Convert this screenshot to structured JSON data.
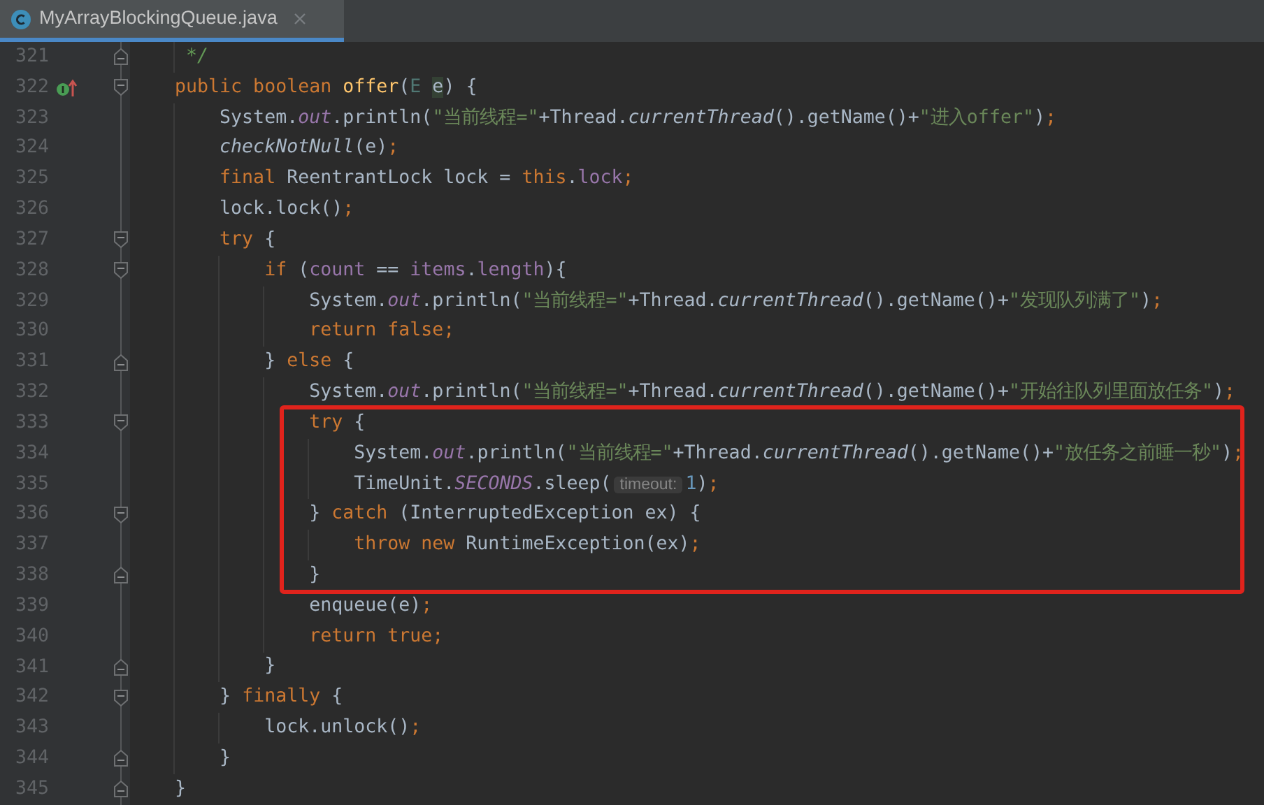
{
  "tab": {
    "title": "MyArrayBlockingQueue.java",
    "selected": true
  },
  "lines": [
    {
      "number": "321",
      "fold": {
        "kind": "end"
      },
      "framed": false,
      "tokens": [
        {
          "kind": "comment",
          "text": "     */"
        }
      ]
    },
    {
      "number": "322",
      "fold": {
        "kind": "start"
      },
      "gutter_icon": {
        "kind": "implements"
      },
      "framed": false,
      "tokens": [
        {
          "kind": "keyword",
          "text": "    public boolean "
        },
        {
          "kind": "method",
          "text": "offer"
        },
        {
          "kind": "plain",
          "text": "("
        },
        {
          "kind": "type_param",
          "text": "E "
        },
        {
          "kind": "highlight",
          "text": "e"
        },
        {
          "kind": "plain",
          "text": ") {"
        }
      ]
    },
    {
      "number": "323",
      "framed": false,
      "tokens": [
        {
          "kind": "plain",
          "text": "        System."
        },
        {
          "kind": "static_field",
          "text": "out"
        },
        {
          "kind": "plain",
          "text": ".println("
        },
        {
          "kind": "string",
          "text": "\"当前线程=\""
        },
        {
          "kind": "plain",
          "text": "+Thread."
        },
        {
          "kind": "static_method",
          "text": "currentThread"
        },
        {
          "kind": "plain",
          "text": "().getName()+"
        },
        {
          "kind": "string",
          "text": "\"进入offer\""
        },
        {
          "kind": "plain",
          "text": ")"
        },
        {
          "kind": "keyword",
          "text": ";"
        }
      ]
    },
    {
      "number": "324",
      "framed": false,
      "tokens": [
        {
          "kind": "static_method",
          "text": "        checkNotNull"
        },
        {
          "kind": "plain",
          "text": "(e)"
        },
        {
          "kind": "keyword",
          "text": ";"
        }
      ]
    },
    {
      "number": "325",
      "framed": false,
      "tokens": [
        {
          "kind": "keyword",
          "text": "        final "
        },
        {
          "kind": "plain",
          "text": "ReentrantLock lock = "
        },
        {
          "kind": "keyword",
          "text": "this"
        },
        {
          "kind": "plain",
          "text": "."
        },
        {
          "kind": "field",
          "text": "lock"
        },
        {
          "kind": "keyword",
          "text": ";"
        }
      ]
    },
    {
      "number": "326",
      "framed": false,
      "tokens": [
        {
          "kind": "plain",
          "text": "        lock.lock()"
        },
        {
          "kind": "keyword",
          "text": ";"
        }
      ]
    },
    {
      "number": "327",
      "fold": {
        "kind": "start"
      },
      "framed": false,
      "tokens": [
        {
          "kind": "keyword",
          "text": "        try "
        },
        {
          "kind": "plain",
          "text": "{"
        }
      ]
    },
    {
      "number": "328",
      "fold": {
        "kind": "start"
      },
      "framed": false,
      "tokens": [
        {
          "kind": "keyword",
          "text": "            if "
        },
        {
          "kind": "plain",
          "text": "("
        },
        {
          "kind": "field",
          "text": "count"
        },
        {
          "kind": "plain",
          "text": " == "
        },
        {
          "kind": "field",
          "text": "items"
        },
        {
          "kind": "plain",
          "text": "."
        },
        {
          "kind": "field",
          "text": "length"
        },
        {
          "kind": "plain",
          "text": "){"
        }
      ]
    },
    {
      "number": "329",
      "framed": false,
      "tokens": [
        {
          "kind": "plain",
          "text": "                System."
        },
        {
          "kind": "static_field",
          "text": "out"
        },
        {
          "kind": "plain",
          "text": ".println("
        },
        {
          "kind": "string",
          "text": "\"当前线程=\""
        },
        {
          "kind": "plain",
          "text": "+Thread."
        },
        {
          "kind": "static_method",
          "text": "currentThread"
        },
        {
          "kind": "plain",
          "text": "().getName()+"
        },
        {
          "kind": "string",
          "text": "\"发现队列满了\""
        },
        {
          "kind": "plain",
          "text": ")"
        },
        {
          "kind": "keyword",
          "text": ";"
        }
      ]
    },
    {
      "number": "330",
      "framed": false,
      "tokens": [
        {
          "kind": "keyword",
          "text": "                return false;"
        }
      ]
    },
    {
      "number": "331",
      "fold": {
        "kind": "end"
      },
      "framed": false,
      "tokens": [
        {
          "kind": "plain",
          "text": "            } "
        },
        {
          "kind": "keyword",
          "text": "else "
        },
        {
          "kind": "plain",
          "text": "{"
        }
      ]
    },
    {
      "number": "332",
      "framed": false,
      "tokens": [
        {
          "kind": "plain",
          "text": "                System."
        },
        {
          "kind": "static_field",
          "text": "out"
        },
        {
          "kind": "plain",
          "text": ".println("
        },
        {
          "kind": "string",
          "text": "\"当前线程=\""
        },
        {
          "kind": "plain",
          "text": "+Thread."
        },
        {
          "kind": "static_method",
          "text": "currentThread"
        },
        {
          "kind": "plain",
          "text": "().getName()+"
        },
        {
          "kind": "string",
          "text": "\"开始往队列里面放任务\""
        },
        {
          "kind": "plain",
          "text": ")"
        },
        {
          "kind": "keyword",
          "text": ";"
        }
      ]
    },
    {
      "number": "333",
      "fold": {
        "kind": "start"
      },
      "framed": true,
      "tokens": [
        {
          "kind": "keyword",
          "text": "                try "
        },
        {
          "kind": "plain",
          "text": "{"
        }
      ]
    },
    {
      "number": "334",
      "framed": true,
      "tokens": [
        {
          "kind": "plain",
          "text": "                    System."
        },
        {
          "kind": "static_field",
          "text": "out"
        },
        {
          "kind": "plain",
          "text": ".println("
        },
        {
          "kind": "string",
          "text": "\"当前线程=\""
        },
        {
          "kind": "plain",
          "text": "+Thread."
        },
        {
          "kind": "static_method",
          "text": "currentThread"
        },
        {
          "kind": "plain",
          "text": "().getName()+"
        },
        {
          "kind": "string",
          "text": "\"放任务之前睡一秒\""
        },
        {
          "kind": "plain",
          "text": ")"
        },
        {
          "kind": "keyword",
          "text": ";"
        }
      ]
    },
    {
      "number": "335",
      "framed": true,
      "tokens": [
        {
          "kind": "plain",
          "text": "                    TimeUnit."
        },
        {
          "kind": "static_field",
          "text": "SECONDS"
        },
        {
          "kind": "plain",
          "text": ".sleep("
        },
        {
          "kind": "hint",
          "text": "timeout:"
        },
        {
          "kind": "number",
          "text": "1"
        },
        {
          "kind": "plain",
          "text": ")"
        },
        {
          "kind": "keyword",
          "text": ";"
        }
      ]
    },
    {
      "number": "336",
      "fold": {
        "kind": "start"
      },
      "framed": true,
      "tokens": [
        {
          "kind": "plain",
          "text": "                } "
        },
        {
          "kind": "keyword",
          "text": "catch "
        },
        {
          "kind": "plain",
          "text": "(InterruptedException ex) {"
        }
      ]
    },
    {
      "number": "337",
      "framed": true,
      "tokens": [
        {
          "kind": "keyword",
          "text": "                    throw new "
        },
        {
          "kind": "plain",
          "text": "RuntimeException(ex)"
        },
        {
          "kind": "keyword",
          "text": ";"
        }
      ]
    },
    {
      "number": "338",
      "fold": {
        "kind": "end"
      },
      "framed": true,
      "tokens": [
        {
          "kind": "plain",
          "text": "                }"
        }
      ]
    },
    {
      "number": "339",
      "framed": false,
      "tokens": [
        {
          "kind": "plain",
          "text": "                enqueue(e)"
        },
        {
          "kind": "keyword",
          "text": ";"
        }
      ]
    },
    {
      "number": "340",
      "framed": false,
      "tokens": [
        {
          "kind": "keyword",
          "text": "                return true;"
        }
      ]
    },
    {
      "number": "341",
      "fold": {
        "kind": "end"
      },
      "framed": false,
      "tokens": [
        {
          "kind": "plain",
          "text": "            }"
        }
      ]
    },
    {
      "number": "342",
      "fold": {
        "kind": "start"
      },
      "framed": false,
      "tokens": [
        {
          "kind": "plain",
          "text": "        } "
        },
        {
          "kind": "keyword",
          "text": "finally "
        },
        {
          "kind": "plain",
          "text": "{"
        }
      ]
    },
    {
      "number": "343",
      "framed": false,
      "tokens": [
        {
          "kind": "plain",
          "text": "            lock.unlock()"
        },
        {
          "kind": "keyword",
          "text": ";"
        }
      ]
    },
    {
      "number": "344",
      "fold": {
        "kind": "end"
      },
      "framed": false,
      "tokens": [
        {
          "kind": "plain",
          "text": "        }"
        }
      ]
    },
    {
      "number": "345",
      "fold": {
        "kind": "end"
      },
      "framed": false,
      "tokens": [
        {
          "kind": "plain",
          "text": "    }"
        }
      ]
    }
  ]
}
